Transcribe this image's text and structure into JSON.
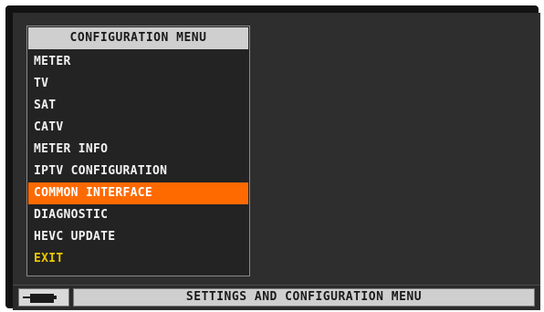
{
  "menu": {
    "title": "CONFIGURATION MENU",
    "items": [
      {
        "label": "METER"
      },
      {
        "label": "TV"
      },
      {
        "label": "SAT"
      },
      {
        "label": "CATV"
      },
      {
        "label": "METER INFO"
      },
      {
        "label": "IPTV CONFIGURATION"
      },
      {
        "label": "COMMON INTERFACE",
        "selected": true
      },
      {
        "label": "DIAGNOSTIC"
      },
      {
        "label": "HEVC UPDATE"
      },
      {
        "label": "EXIT"
      }
    ]
  },
  "status_bar": {
    "icon": "battery-plug-icon",
    "text": "SETTINGS AND CONFIGURATION MENU"
  },
  "colors": {
    "selection": "#ff6a00",
    "exit": "#e8c800",
    "background": "#2e2e2e",
    "title_bar": "#cfcfcf"
  }
}
